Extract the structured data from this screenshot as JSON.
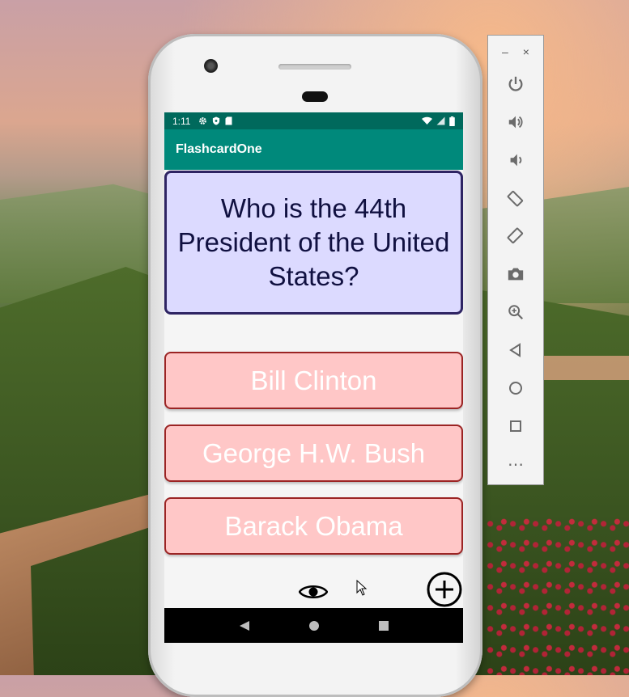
{
  "statusbar": {
    "time": "1:11"
  },
  "app": {
    "title": "FlashcardOne"
  },
  "question": {
    "text": "Who is the 44th President of the United States?"
  },
  "answers": [
    {
      "label": "Bill Clinton"
    },
    {
      "label": "George H.W. Bush"
    },
    {
      "label": "Barack Obama"
    }
  ],
  "emulator_toolbar": {
    "minimize": "–",
    "close": "×",
    "more": "⋯"
  },
  "colors": {
    "statusbar": "#00695c",
    "appbar": "#00897b",
    "question_bg": "#dcdaff",
    "question_border": "#2e2463",
    "answer_bg": "#ffc7c7",
    "answer_border": "#9b2424"
  },
  "icons": [
    "settings-icon",
    "shield-icon",
    "sd-card-icon",
    "wifi-icon",
    "signal-icon",
    "battery-icon",
    "eye-icon",
    "add-circle-icon",
    "back-icon",
    "home-icon",
    "overview-icon",
    "power-icon",
    "volume-up-icon",
    "volume-down-icon",
    "rotate-left-icon",
    "rotate-right-icon",
    "camera-icon",
    "zoom-icon"
  ]
}
